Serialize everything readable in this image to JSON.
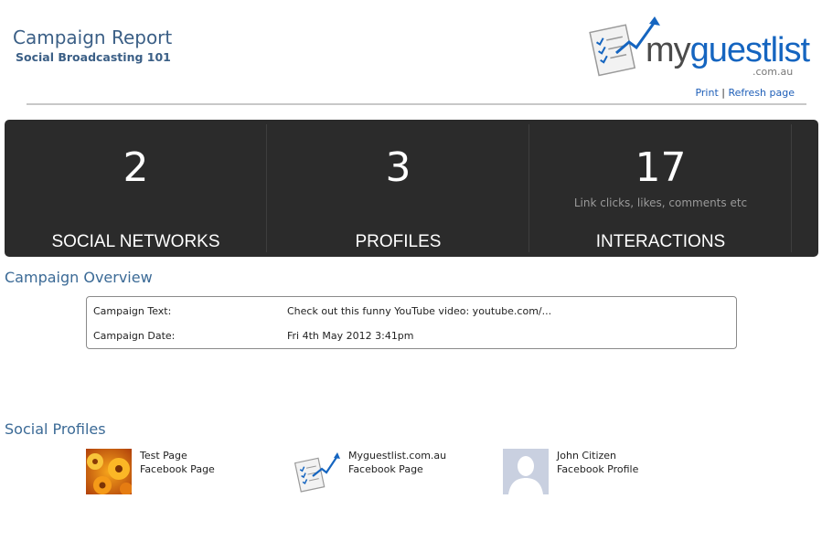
{
  "header": {
    "title": "Campaign Report",
    "subtitle": "Social Broadcasting 101"
  },
  "logo": {
    "text_my": "my",
    "text_guestlist": "guestlist",
    "domain": ".com.au",
    "colors": {
      "dark": "#4b4b4b",
      "blue": "#1565c0"
    }
  },
  "links": {
    "print": "Print",
    "separator": "|",
    "refresh": "Refresh page"
  },
  "stats": [
    {
      "value": "2",
      "label": "SOCIAL NETWORKS",
      "description": ""
    },
    {
      "value": "3",
      "label": "PROFILES",
      "description": ""
    },
    {
      "value": "17",
      "label": "INTERACTIONS",
      "description": "Link clicks, likes, comments etc"
    }
  ],
  "overview": {
    "section_title": "Campaign Overview",
    "rows": [
      {
        "key": "Campaign Text:",
        "value": "Check out this funny YouTube video: youtube.com/..."
      },
      {
        "key": "Campaign Date:",
        "value": "Fri 4th May 2012 3:41pm"
      }
    ]
  },
  "profiles": {
    "section_title": "Social Profiles",
    "items": [
      {
        "name": "Test Page",
        "type": "Facebook Page",
        "avatar": "flower-photo"
      },
      {
        "name": "Myguestlist.com.au",
        "type": "Facebook Page",
        "avatar": "myguestlist-logo-icon"
      },
      {
        "name": "John Citizen",
        "type": "Facebook Profile",
        "avatar": "default-person-silhouette"
      }
    ]
  },
  "colors": {
    "heading_blue": "#3b5f86",
    "link_blue": "#1f5fb8",
    "stats_bg": "#2b2b2b"
  }
}
